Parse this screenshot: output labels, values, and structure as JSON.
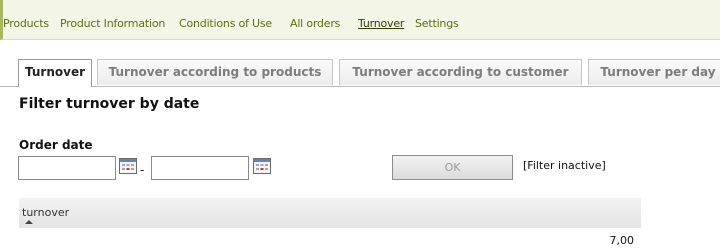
{
  "nav": {
    "items": [
      {
        "label": "Products",
        "active": false
      },
      {
        "label": "Product Information",
        "active": false
      },
      {
        "label": "Conditions of Use",
        "active": false
      },
      {
        "label": "All orders",
        "active": false
      },
      {
        "label": "Turnover",
        "active": true
      },
      {
        "label": "Settings",
        "active": false
      }
    ]
  },
  "tabs": [
    {
      "label": "Turnover",
      "active": true
    },
    {
      "label": "Turnover according to products",
      "active": false
    },
    {
      "label": "Turnover according to customer",
      "active": false
    },
    {
      "label": "Turnover per day",
      "active": false
    }
  ],
  "filter": {
    "title": "Filter turnover by date",
    "order_date_label": "Order date",
    "from_value": "",
    "to_value": "",
    "separator": "-",
    "ok_label": "OK",
    "status": "[Filter inactive]"
  },
  "table": {
    "column": "turnover",
    "value": "7,00"
  },
  "icons": {
    "calendar": "calendar-icon",
    "sort": "sort-ascending-icon"
  },
  "colors": {
    "nav_link": "#5a6d13",
    "nav_background": "#f3f6e7"
  }
}
